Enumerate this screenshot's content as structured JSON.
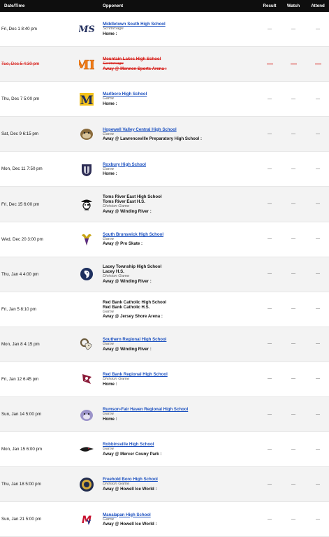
{
  "header": {
    "date_label": "Date/Time",
    "opponent_label": "Opponent",
    "result_label": "Result",
    "watch_label": "Watch",
    "attend_label": "Attend"
  },
  "games": [
    {
      "date": "Fri, Dec 1 8:40 pm",
      "opponent": "Middletown South High School",
      "opponent_sub": "",
      "type": "Scrimmage",
      "location": "Home :",
      "result": "---",
      "watch": "---",
      "attend": "---",
      "logo": "ms-logo"
    },
    {
      "date": "Tue, Dec 5 4:30 pm",
      "opponent": "Mountain Lakes High School",
      "opponent_sub": "",
      "type": "Scrimmage",
      "location": "Away @ Mennen Sports Arena :",
      "result": "—",
      "watch": "—",
      "attend": "—",
      "logo": "ml-logo"
    },
    {
      "date": "Thu, Dec 7 5:00 pm",
      "opponent": "Marlboro High School",
      "opponent_sub": "",
      "type": "Game",
      "location": "Home :",
      "result": "---",
      "watch": "---",
      "attend": "---",
      "logo": "m-logo"
    },
    {
      "date": "Sat, Dec 9 6:15 pm",
      "opponent": "Hopewell Valley Central High School",
      "opponent_sub": "",
      "type": "Game",
      "location": "Away @ Lawrenceville Preparatory High School :",
      "result": "---",
      "watch": "---",
      "attend": "---",
      "logo": "bulldog-logo"
    },
    {
      "date": "Mon, Dec 11 7:50 pm",
      "opponent": "Roxbury High School",
      "opponent_sub": "",
      "type": "Game",
      "location": "Home :",
      "result": "---",
      "watch": "---",
      "attend": "---",
      "logo": "gael-helmet-logo"
    },
    {
      "date": "Fri, Dec 15 6:00 pm",
      "opponent": "Toms River East High School",
      "opponent_sub": "Toms River East H.S.",
      "type": "Division Game",
      "location": "Away @ Winding River :",
      "result": "---",
      "watch": "---",
      "attend": "---",
      "logo": "pirate-logo"
    },
    {
      "date": "Wed, Dec 20 3:00 pm",
      "opponent": "South Brunswick High School",
      "opponent_sub": "",
      "type": "Game",
      "location": "Away @ Pro Skate :",
      "result": "---",
      "watch": "---",
      "attend": "---",
      "logo": "viking-logo"
    },
    {
      "date": "Thu, Jan 4 4:00 pm",
      "opponent": "Lacey Township High School",
      "opponent_sub": "Lacey H.S.",
      "type": "Division Game",
      "location": "Away @ Winding River :",
      "result": "---",
      "watch": "---",
      "attend": "---",
      "logo": "lion-logo"
    },
    {
      "date": "Fri, Jan 5 8:10 pm",
      "opponent": "Red Bank Catholic High School",
      "opponent_sub": "Red Bank Catholic H.S.",
      "type": "Game",
      "location": "Away @ Jersey Shore Arena :",
      "result": "---",
      "watch": "---",
      "attend": "---",
      "logo": ""
    },
    {
      "date": "Mon, Jan 8 4:15 pm",
      "opponent": "Southern Regional High School",
      "opponent_sub": "",
      "type": "Game",
      "location": "Away @ Winding River :",
      "result": "---",
      "watch": "---",
      "attend": "---",
      "logo": "ram-logo"
    },
    {
      "date": "Fri, Jan 12 6:45 pm",
      "opponent": "Red Bank Regional High School",
      "opponent_sub": "",
      "type": "Division Game",
      "location": "Home :",
      "result": "---",
      "watch": "---",
      "attend": "---",
      "logo": "buccaneer-flag-logo"
    },
    {
      "date": "Sun, Jan 14 5:00 pm",
      "opponent": "Rumson-Fair Haven Regional High School",
      "opponent_sub": "",
      "type": "Game",
      "location": "Home :",
      "result": "---",
      "watch": "---",
      "attend": "---",
      "logo": "bulldog-purple-logo"
    },
    {
      "date": "Mon, Jan 15 6:00 pm",
      "opponent": "Robbinsville High School",
      "opponent_sub": "",
      "type": "Game",
      "location": "Away @ Mercer Couny Park :",
      "result": "---",
      "watch": "---",
      "attend": "---",
      "logo": "raven-logo"
    },
    {
      "date": "Thu, Jan 18 5:00 pm",
      "opponent": "Freehold Boro High School",
      "opponent_sub": "",
      "type": "Division Game",
      "location": "Away @ Howell Ice World :",
      "result": "---",
      "watch": "---",
      "attend": "---",
      "logo": "crest-logo"
    },
    {
      "date": "Sun, Jan 21 5:00 pm",
      "opponent": "Manalapan High School",
      "opponent_sub": "",
      "type": "Game",
      "location": "Away @ Howell Ice World :",
      "result": "---",
      "watch": "---",
      "attend": "---",
      "logo": "mb-logo"
    }
  ],
  "colors": {
    "header_bg": "#0e0e0e",
    "link": "#1a4fbf",
    "cancel": "#d6140f",
    "row_alt": "#f3f3f3"
  }
}
